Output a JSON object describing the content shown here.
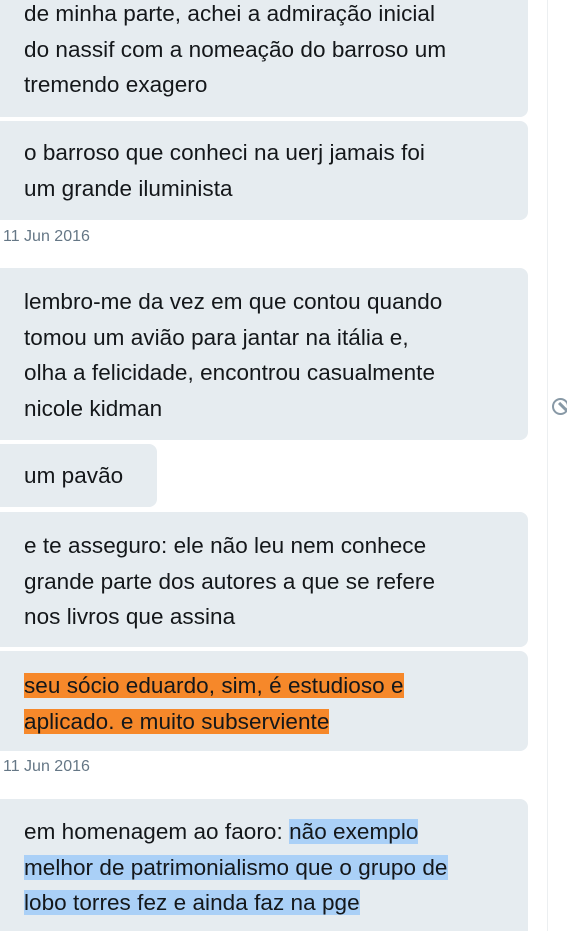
{
  "conversation": {
    "messages": [
      {
        "lines": [
          "de minha parte, achei a admiração inicial",
          "do nassif com a nomeação do barroso um",
          "tremendo exagero"
        ]
      },
      {
        "lines": [
          "o barroso que conheci na uerj jamais foi",
          "um grande iluminista"
        ]
      },
      {
        "lines": [
          "lembro-me da vez em que contou quando",
          "tomou um avião para jantar na itália e,",
          "olha a felicidade, encontrou casualmente",
          "nicole kidman"
        ]
      },
      {
        "lines": [
          "um pavão"
        ]
      },
      {
        "lines": [
          "e te asseguro: ele não leu nem conhece",
          "grande parte dos autores a que se refere",
          "nos livros que assina"
        ]
      },
      {
        "lines": [
          "seu sócio eduardo, sim, é estudioso e ",
          "aplicado. e muito subserviente"
        ],
        "highlight_color": "#f6882a"
      },
      {
        "line1_plain": "em homenagem ao faoro: ",
        "line1_highlight": "não exemplo ",
        "lines_highlight": [
          "melhor de patrimonialismo que o grupo de ",
          "lobo torres fez e ainda faz na pge"
        ],
        "highlight_color": "#aad0f7"
      }
    ],
    "timestamps": [
      "11 Jun 2016",
      "11 Jun 2016"
    ],
    "status_icon": "blocked-icon"
  }
}
